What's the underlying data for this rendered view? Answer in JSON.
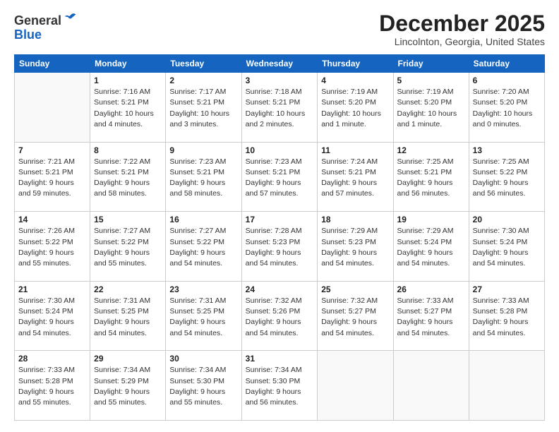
{
  "logo": {
    "general": "General",
    "blue": "Blue"
  },
  "title": "December 2025",
  "location": "Lincolnton, Georgia, United States",
  "days_header": [
    "Sunday",
    "Monday",
    "Tuesday",
    "Wednesday",
    "Thursday",
    "Friday",
    "Saturday"
  ],
  "weeks": [
    [
      {
        "day": "",
        "info": ""
      },
      {
        "day": "1",
        "info": "Sunrise: 7:16 AM\nSunset: 5:21 PM\nDaylight: 10 hours\nand 4 minutes."
      },
      {
        "day": "2",
        "info": "Sunrise: 7:17 AM\nSunset: 5:21 PM\nDaylight: 10 hours\nand 3 minutes."
      },
      {
        "day": "3",
        "info": "Sunrise: 7:18 AM\nSunset: 5:21 PM\nDaylight: 10 hours\nand 2 minutes."
      },
      {
        "day": "4",
        "info": "Sunrise: 7:19 AM\nSunset: 5:20 PM\nDaylight: 10 hours\nand 1 minute."
      },
      {
        "day": "5",
        "info": "Sunrise: 7:19 AM\nSunset: 5:20 PM\nDaylight: 10 hours\nand 1 minute."
      },
      {
        "day": "6",
        "info": "Sunrise: 7:20 AM\nSunset: 5:20 PM\nDaylight: 10 hours\nand 0 minutes."
      }
    ],
    [
      {
        "day": "7",
        "info": "Sunrise: 7:21 AM\nSunset: 5:21 PM\nDaylight: 9 hours\nand 59 minutes."
      },
      {
        "day": "8",
        "info": "Sunrise: 7:22 AM\nSunset: 5:21 PM\nDaylight: 9 hours\nand 58 minutes."
      },
      {
        "day": "9",
        "info": "Sunrise: 7:23 AM\nSunset: 5:21 PM\nDaylight: 9 hours\nand 58 minutes."
      },
      {
        "day": "10",
        "info": "Sunrise: 7:23 AM\nSunset: 5:21 PM\nDaylight: 9 hours\nand 57 minutes."
      },
      {
        "day": "11",
        "info": "Sunrise: 7:24 AM\nSunset: 5:21 PM\nDaylight: 9 hours\nand 57 minutes."
      },
      {
        "day": "12",
        "info": "Sunrise: 7:25 AM\nSunset: 5:21 PM\nDaylight: 9 hours\nand 56 minutes."
      },
      {
        "day": "13",
        "info": "Sunrise: 7:25 AM\nSunset: 5:22 PM\nDaylight: 9 hours\nand 56 minutes."
      }
    ],
    [
      {
        "day": "14",
        "info": "Sunrise: 7:26 AM\nSunset: 5:22 PM\nDaylight: 9 hours\nand 55 minutes."
      },
      {
        "day": "15",
        "info": "Sunrise: 7:27 AM\nSunset: 5:22 PM\nDaylight: 9 hours\nand 55 minutes."
      },
      {
        "day": "16",
        "info": "Sunrise: 7:27 AM\nSunset: 5:22 PM\nDaylight: 9 hours\nand 54 minutes."
      },
      {
        "day": "17",
        "info": "Sunrise: 7:28 AM\nSunset: 5:23 PM\nDaylight: 9 hours\nand 54 minutes."
      },
      {
        "day": "18",
        "info": "Sunrise: 7:29 AM\nSunset: 5:23 PM\nDaylight: 9 hours\nand 54 minutes."
      },
      {
        "day": "19",
        "info": "Sunrise: 7:29 AM\nSunset: 5:24 PM\nDaylight: 9 hours\nand 54 minutes."
      },
      {
        "day": "20",
        "info": "Sunrise: 7:30 AM\nSunset: 5:24 PM\nDaylight: 9 hours\nand 54 minutes."
      }
    ],
    [
      {
        "day": "21",
        "info": "Sunrise: 7:30 AM\nSunset: 5:24 PM\nDaylight: 9 hours\nand 54 minutes."
      },
      {
        "day": "22",
        "info": "Sunrise: 7:31 AM\nSunset: 5:25 PM\nDaylight: 9 hours\nand 54 minutes."
      },
      {
        "day": "23",
        "info": "Sunrise: 7:31 AM\nSunset: 5:25 PM\nDaylight: 9 hours\nand 54 minutes."
      },
      {
        "day": "24",
        "info": "Sunrise: 7:32 AM\nSunset: 5:26 PM\nDaylight: 9 hours\nand 54 minutes."
      },
      {
        "day": "25",
        "info": "Sunrise: 7:32 AM\nSunset: 5:27 PM\nDaylight: 9 hours\nand 54 minutes."
      },
      {
        "day": "26",
        "info": "Sunrise: 7:33 AM\nSunset: 5:27 PM\nDaylight: 9 hours\nand 54 minutes."
      },
      {
        "day": "27",
        "info": "Sunrise: 7:33 AM\nSunset: 5:28 PM\nDaylight: 9 hours\nand 54 minutes."
      }
    ],
    [
      {
        "day": "28",
        "info": "Sunrise: 7:33 AM\nSunset: 5:28 PM\nDaylight: 9 hours\nand 55 minutes."
      },
      {
        "day": "29",
        "info": "Sunrise: 7:34 AM\nSunset: 5:29 PM\nDaylight: 9 hours\nand 55 minutes."
      },
      {
        "day": "30",
        "info": "Sunrise: 7:34 AM\nSunset: 5:30 PM\nDaylight: 9 hours\nand 55 minutes."
      },
      {
        "day": "31",
        "info": "Sunrise: 7:34 AM\nSunset: 5:30 PM\nDaylight: 9 hours\nand 56 minutes."
      },
      {
        "day": "",
        "info": ""
      },
      {
        "day": "",
        "info": ""
      },
      {
        "day": "",
        "info": ""
      }
    ]
  ]
}
